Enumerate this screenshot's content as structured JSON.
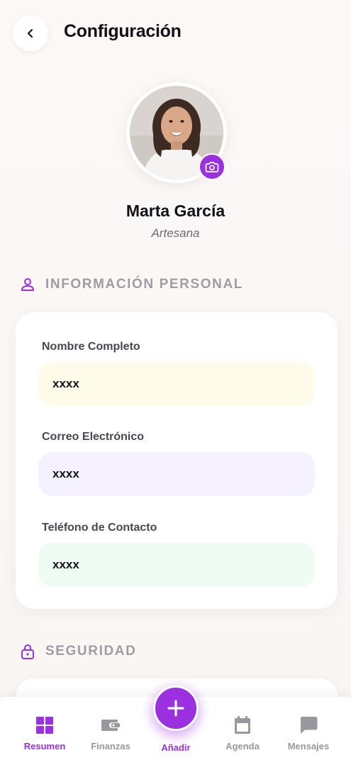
{
  "header": {
    "title": "Configuración",
    "back_icon": "chevron-left-icon"
  },
  "profile": {
    "name": "Marta García",
    "role": "Artesana",
    "camera_icon": "camera-icon"
  },
  "sections": {
    "personal": {
      "title": "INFORMACIÓN PERSONAL",
      "icon": "user-icon",
      "fields": [
        {
          "label": "Nombre Completo",
          "value": "xxxx",
          "color": "#fffbea"
        },
        {
          "label": "Correo Electrónico",
          "value": "xxxx",
          "color": "#f6f1fe"
        },
        {
          "label": "Teléfono de Contacto",
          "value": "xxxx",
          "color": "#effcf4"
        }
      ]
    },
    "security": {
      "title": "SEGURIDAD",
      "icon": "lock-icon"
    }
  },
  "nav": {
    "items": [
      {
        "label": "Resumen",
        "icon": "grid-icon",
        "active": true
      },
      {
        "label": "Finanzas",
        "icon": "wallet-icon",
        "active": false
      },
      {
        "label": "Añadir",
        "icon": "plus-icon",
        "active": false
      },
      {
        "label": "Agenda",
        "icon": "calendar-icon",
        "active": false
      },
      {
        "label": "Mensajes",
        "icon": "chat-icon",
        "active": false
      }
    ]
  },
  "colors": {
    "accent": "#9b30e0",
    "muted": "#a19ca4",
    "background": "#faf7f5"
  }
}
